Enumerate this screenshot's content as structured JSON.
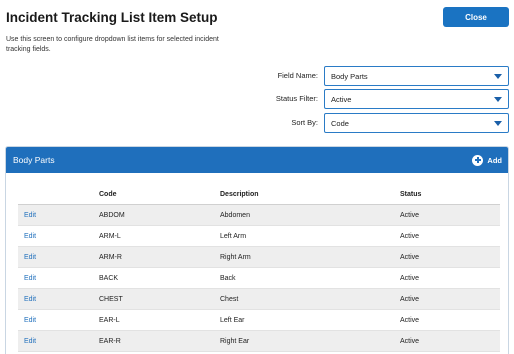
{
  "page": {
    "title": "Incident Tracking List Item Setup",
    "close_label": "Close",
    "description": "Use this screen to configure dropdown list items for selected incident tracking fields."
  },
  "filters": {
    "field_name": {
      "label": "Field Name:",
      "value": "Body Parts"
    },
    "status_filter": {
      "label": "Status Filter:",
      "value": "Active"
    },
    "sort_by": {
      "label": "Sort By:",
      "value": "Code"
    }
  },
  "panel": {
    "title": "Body Parts",
    "add_label": "Add",
    "columns": [
      "",
      "Code",
      "Description",
      "Status"
    ],
    "rows": [
      {
        "action": "Edit",
        "code": "ABDOM",
        "description": "Abdomen",
        "status": "Active"
      },
      {
        "action": "Edit",
        "code": "ARM-L",
        "description": "Left Arm",
        "status": "Active"
      },
      {
        "action": "Edit",
        "code": "ARM-R",
        "description": "Right Arm",
        "status": "Active"
      },
      {
        "action": "Edit",
        "code": "BACK",
        "description": "Back",
        "status": "Active"
      },
      {
        "action": "Edit",
        "code": "CHEST",
        "description": "Chest",
        "status": "Active"
      },
      {
        "action": "Edit",
        "code": "EAR-L",
        "description": "Left Ear",
        "status": "Active"
      },
      {
        "action": "Edit",
        "code": "EAR-R",
        "description": "Right Ear",
        "status": "Active"
      }
    ]
  },
  "colors": {
    "accent": "#1f6fbc",
    "row_alt": "#eeeeee"
  }
}
